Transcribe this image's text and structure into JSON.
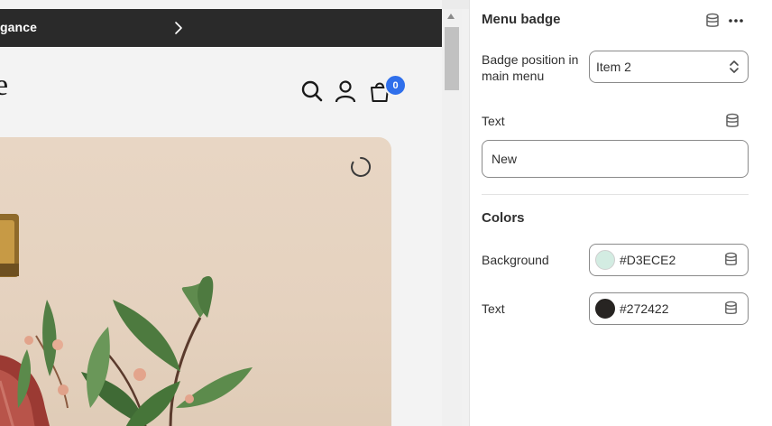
{
  "preview": {
    "announcement_text": "gance",
    "logo_fragment": "e",
    "cart_count": "0"
  },
  "panel": {
    "title": "Menu badge",
    "badge_position_label": "Badge position in main menu",
    "badge_position_value": "Item 2",
    "text_label": "Text",
    "text_value": "New",
    "colors_heading": "Colors",
    "background_label": "Background",
    "background_value": "#D3ECE2",
    "text_color_label": "Text",
    "text_color_value": "#272422"
  },
  "colors": {
    "badge_background": "#D3ECE2",
    "badge_text": "#272422",
    "cart_badge": "#2f6feb",
    "announcement_bar": "#2a2a2a"
  },
  "icons": {
    "announcement_next": "chevron-right-icon",
    "header_search": "search-icon",
    "header_account": "account-icon",
    "header_cart": "cart-icon",
    "panel_dynamic_source": "database-icon",
    "panel_more": "more-dots-icon",
    "select": "select-chevrons-icon",
    "loading": "spinner-icon"
  }
}
